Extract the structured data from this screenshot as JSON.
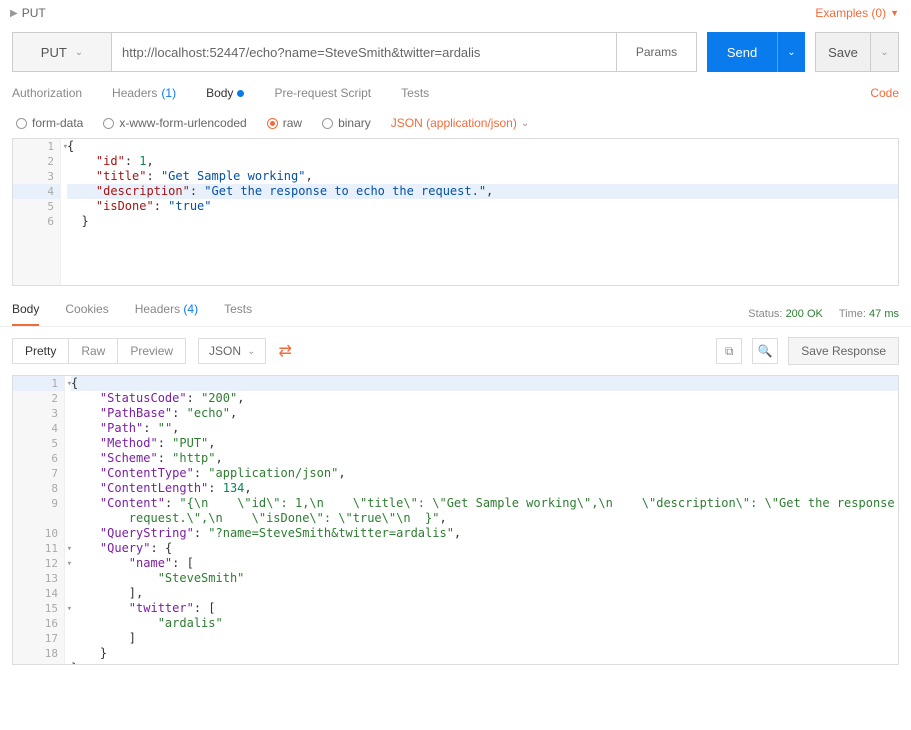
{
  "topbar": {
    "method": "PUT",
    "examples": "Examples (0)"
  },
  "reqbar": {
    "method": "PUT",
    "url": "http://localhost:52447/echo?name=SteveSmith&twitter=ardalis",
    "params": "Params",
    "send": "Send",
    "save": "Save"
  },
  "req_tabs": {
    "authorization": "Authorization",
    "headers": "Headers",
    "headers_count": "(1)",
    "body": "Body",
    "prerequest": "Pre-request Script",
    "tests": "Tests",
    "code": "Code"
  },
  "body_opts": {
    "formdata": "form-data",
    "xwww": "x-www-form-urlencoded",
    "raw": "raw",
    "binary": "binary",
    "content_type": "JSON (application/json)"
  },
  "req_body": {
    "line1": "{",
    "line2_key": "\"id\"",
    "line2_val": "1",
    "line3_key": "\"title\"",
    "line3_val": "\"Get Sample working\"",
    "line4_key": "\"description\"",
    "line4_val": "\"Get the response to echo the request.\"",
    "line5_key": "\"isDone\"",
    "line5_val": "\"true\"",
    "line6": "}"
  },
  "resp_tabs": {
    "body": "Body",
    "cookies": "Cookies",
    "headers": "Headers",
    "headers_count": "(4)",
    "tests": "Tests"
  },
  "resp_meta": {
    "status_label": "Status:",
    "status_value": "200 OK",
    "time_label": "Time:",
    "time_value": "47 ms"
  },
  "resp_toolbar": {
    "pretty": "Pretty",
    "raw": "Raw",
    "preview": "Preview",
    "format": "JSON",
    "save_response": "Save Response"
  },
  "resp_body": {
    "l1": "{",
    "l2k": "\"StatusCode\"",
    "l2v": "\"200\"",
    "l3k": "\"PathBase\"",
    "l3v": "\"echo\"",
    "l4k": "\"Path\"",
    "l4v": "\"\"",
    "l5k": "\"Method\"",
    "l5v": "\"PUT\"",
    "l6k": "\"Scheme\"",
    "l6v": "\"http\"",
    "l7k": "\"ContentType\"",
    "l7v": "\"application/json\"",
    "l8k": "\"ContentLength\"",
    "l8v": "134",
    "l9k": "\"Content\"",
    "l9v_a": "\"{\\n    \\\"id\\\": 1,\\n    \\\"title\\\": \\\"Get Sample working\\\",\\n    \\\"description\\\": \\\"Get the response to echo the",
    "l9v_b": "request.\\\",\\n    \\\"isDone\\\": \\\"true\\\"\\n  }\"",
    "l10k": "\"QueryString\"",
    "l10v": "\"?name=SteveSmith&twitter=ardalis\"",
    "l11k": "\"Query\"",
    "l12k": "\"name\"",
    "l13v": "\"SteveSmith\"",
    "l15k": "\"twitter\"",
    "l16v": "\"ardalis\"",
    "brace_open": "{",
    "brace_close": "}",
    "bracket_open": "[",
    "bracket_close": "]"
  }
}
